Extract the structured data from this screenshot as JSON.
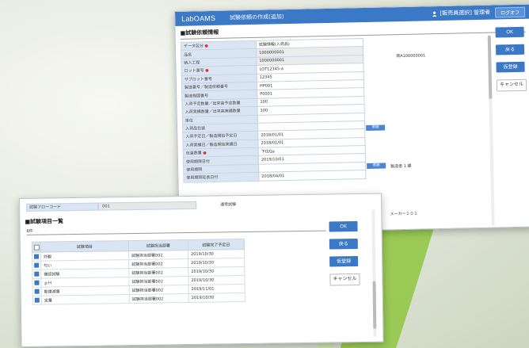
{
  "app": {
    "logo": "LabOAMS",
    "window_title": "試験依頼の作成(追加)",
    "user": "[販売員選択] 管理者",
    "logout": "ログオフ"
  },
  "back": {
    "section_title": "■試験依頼情報",
    "fields": [
      {
        "label": "データ区分",
        "required": true,
        "value": "試験情報(入荷品)"
      },
      {
        "label": "品名",
        "required": false,
        "value": "1000000001"
      },
      {
        "label": "納入工程",
        "required": false,
        "value": "1000000001"
      },
      {
        "label": "ロット番号",
        "required": true,
        "value": "LOT12345-a"
      },
      {
        "label": "サブロット番号",
        "required": false,
        "value": "12345"
      },
      {
        "label": "製造番号／製造依頼番号",
        "required": false,
        "value": "HP001"
      },
      {
        "label": "製造指図番号",
        "required": false,
        "value": "P0001"
      },
      {
        "label": "入荷予定数量／出来高予定数量",
        "required": false,
        "value": "100"
      },
      {
        "label": "入荷実績数量／出来高実績数量",
        "required": false,
        "value": "100"
      },
      {
        "label": "単位",
        "required": false,
        "value": ""
      },
      {
        "label": "入荷品包装",
        "required": false,
        "value": ""
      },
      {
        "label": "入荷予定日／製造開始予定日",
        "required": false,
        "value": "2018/01/01"
      },
      {
        "label": "入荷実績日／製造開始実績日",
        "required": false,
        "value": "2018/01/01"
      },
      {
        "label": "包装数量",
        "required": true,
        "value": "下位Qa"
      },
      {
        "label": "使用期限日付",
        "required": false,
        "value": "2019/10/01"
      },
      {
        "label": "使用期限",
        "required": false,
        "value": ""
      },
      {
        "label": "使用期限延長日付",
        "required": false,
        "value": "2018/04/01"
      }
    ],
    "side_value": "商A100000001",
    "ref_label": "参照",
    "ref_note": "製造者 1 課",
    "maker_note": "メーカー１０１",
    "buttons": [
      "OK",
      "戻る",
      "仮登録",
      "キャンセル"
    ]
  },
  "front": {
    "top_label": "試験フローコード",
    "top_value": "001",
    "top_note": "通常試験",
    "section_title": "■試験項目一覧",
    "count": "6件",
    "columns": [
      "試験項目",
      "試験担当部署",
      "試験完了予定日"
    ],
    "rows": [
      {
        "name": "外観",
        "dept": "試験担当部署002",
        "date": "2019/10/30"
      },
      {
        "name": "匂い",
        "dept": "試験担当部署002",
        "date": "2019/10/30"
      },
      {
        "name": "確認試験",
        "dept": "試験担当部署002",
        "date": "2019/10/30"
      },
      {
        "name": "ｐＨ",
        "dept": "試験担当部署002",
        "date": "2019/10/30"
      },
      {
        "name": "乾燥減量",
        "dept": "試験担当部署002",
        "date": "2019/11/01"
      },
      {
        "name": "定量",
        "dept": "試験担当部署002",
        "date": "2019/10/30"
      }
    ],
    "buttons": [
      "OK",
      "戻る",
      "仮登録",
      "キャンセル"
    ]
  },
  "colors": {
    "accent": "#3b78c6",
    "label_bg": "#d9e5f3",
    "swoosh": "#8fc63f"
  }
}
